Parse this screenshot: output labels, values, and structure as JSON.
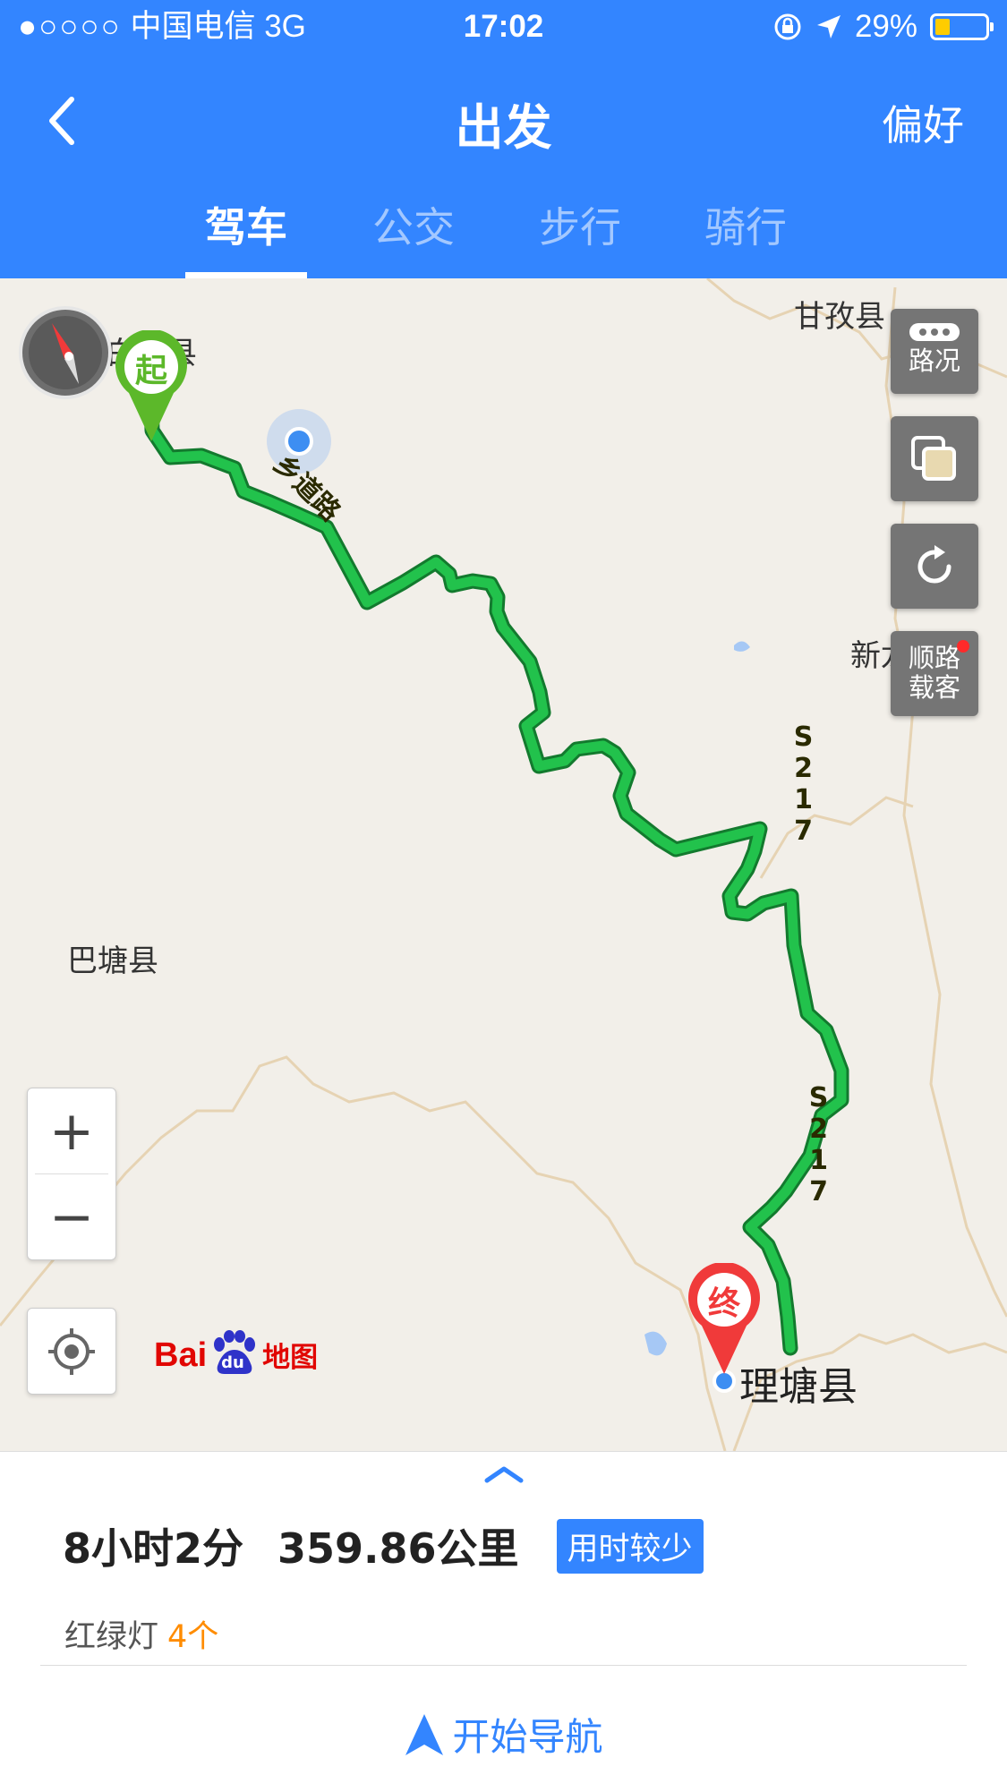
{
  "status_bar": {
    "signal": "●○○○○",
    "carrier": "中国电信",
    "network": "3G",
    "time": "17:02",
    "battery_percent": "29%",
    "battery_level": 0.29
  },
  "header": {
    "title": "出发",
    "preference": "偏好",
    "tabs": [
      {
        "label": "驾车",
        "active": true
      },
      {
        "label": "公交",
        "active": false
      },
      {
        "label": "步行",
        "active": false
      },
      {
        "label": "骑行",
        "active": false
      }
    ]
  },
  "map": {
    "places": {
      "start_county": "白玉县",
      "ganzi": "甘孜县",
      "xinlong": "新龙县",
      "batang": "巴塘县",
      "litang": "理塘县"
    },
    "start_marker": "起",
    "end_marker": "终",
    "road_labels": {
      "road_a": "乡道路",
      "road_b": "S217",
      "road_c": "S217"
    },
    "controls": {
      "traffic": "路况",
      "layers": "",
      "refresh": "",
      "carpool_line1": "顺路",
      "carpool_line2": "载客",
      "zoom_in": "+",
      "zoom_out": "−"
    },
    "logo": {
      "brand": "Bai",
      "du": "du",
      "suffix": "地图"
    },
    "route_color": "#22b24c",
    "route_border": "#137a2e"
  },
  "route_panel": {
    "duration": "8小时2分",
    "distance": "359.86公里",
    "tag": "用时较少",
    "traffic_lights_label": "红绿灯",
    "traffic_lights_count": "4个",
    "start_navigation": "开始导航"
  },
  "colors": {
    "primary": "#3385ff",
    "accent_orange": "#ff8c00",
    "end_pin": "#f03a3a",
    "start_pin": "#5cb82a"
  }
}
